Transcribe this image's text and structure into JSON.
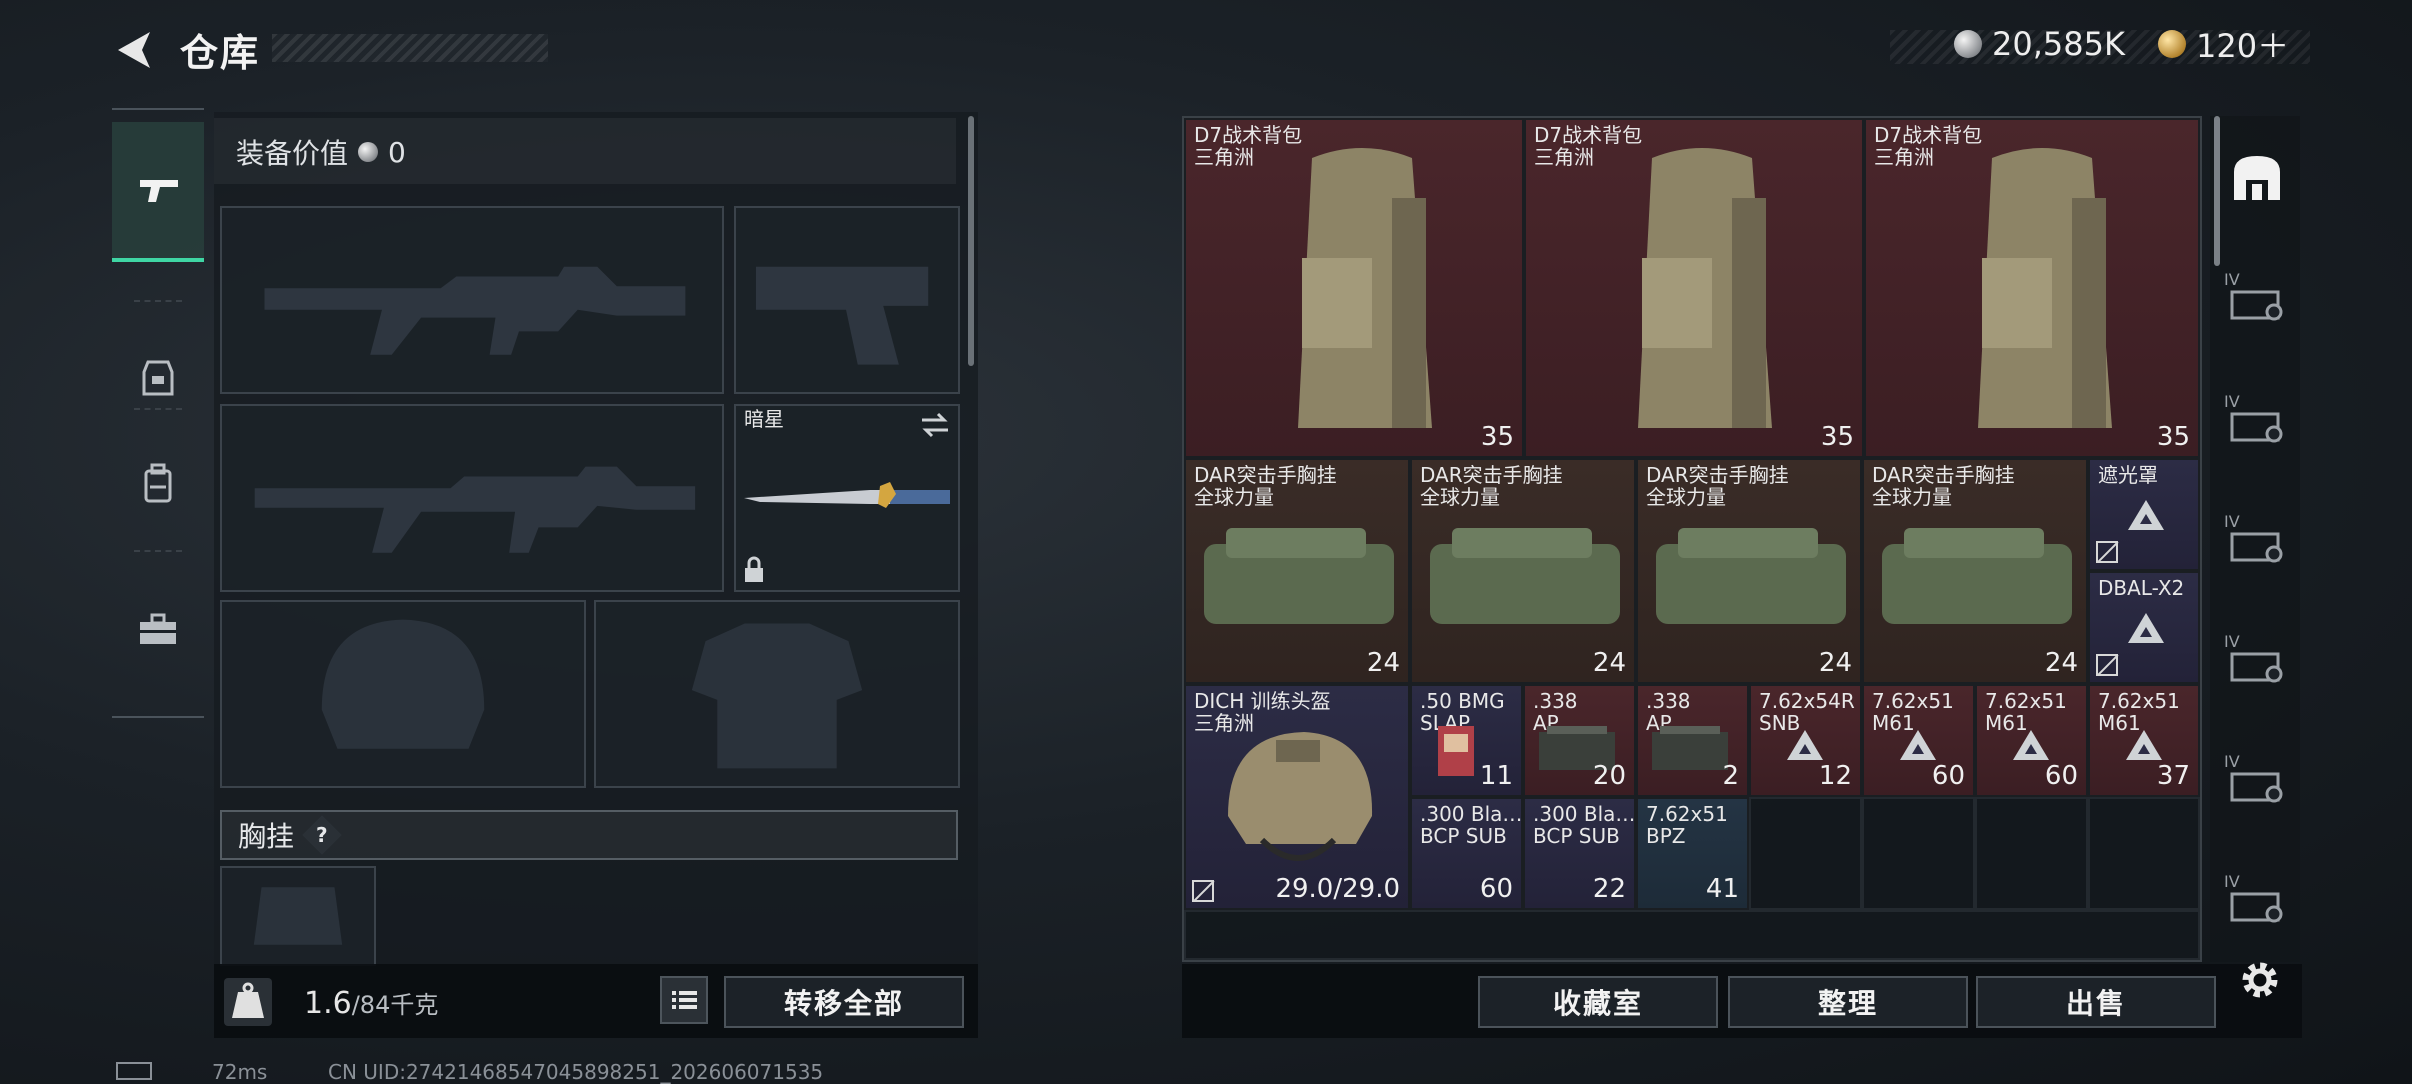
{
  "header": {
    "title": "仓库",
    "currency_silver": "20,585K",
    "currency_gold": "120＋"
  },
  "equip": {
    "value_label": "装备价值",
    "value_amount": "0",
    "knife_name": "暗星",
    "chest_label": "胸挂",
    "chest_help": "?",
    "weight_value": "1.6",
    "weight_total": "/84千克",
    "transfer_all": "转移全部"
  },
  "storage": {
    "row1": [
      {
        "name": "D7战术背包",
        "sub": "三角洲",
        "qty": "35"
      },
      {
        "name": "D7战术背包",
        "sub": "三角洲",
        "qty": "35"
      },
      {
        "name": "D7战术背包",
        "sub": "三角洲",
        "qty": "35"
      }
    ],
    "row2": [
      {
        "name": "DAR突击手胸挂",
        "sub": "全球力量",
        "qty": "24"
      },
      {
        "name": "DAR突击手胸挂",
        "sub": "全球力量",
        "qty": "24"
      },
      {
        "name": "DAR突击手胸挂",
        "sub": "全球力量",
        "qty": "24"
      },
      {
        "name": "DAR突击手胸挂",
        "sub": "全球力量",
        "qty": "24"
      }
    ],
    "small_mods": [
      {
        "name": "遮光罩"
      },
      {
        "name": "DBAL-X2"
      }
    ],
    "helmet": {
      "name": "DICH 训练头盔",
      "sub": "三角洲",
      "qty": "29.0/29.0"
    },
    "ammo_row1": [
      {
        "name": ".50 BMG",
        "sub": "SLAP",
        "qty": "11"
      },
      {
        "name": ".338",
        "sub": "AP",
        "qty": "20"
      },
      {
        "name": ".338",
        "sub": "AP",
        "qty": "2"
      },
      {
        "name": "7.62x54R",
        "sub": "SNB",
        "qty": "12"
      },
      {
        "name": "7.62x51",
        "sub": "M61",
        "qty": "60"
      },
      {
        "name": "7.62x51",
        "sub": "M61",
        "qty": "60"
      },
      {
        "name": "7.62x51",
        "sub": "M61",
        "qty": "37"
      }
    ],
    "ammo_row2": [
      {
        "name": ".300 Bla…",
        "sub": "BCP SUB",
        "qty": "60"
      },
      {
        "name": ".300 Bla…",
        "sub": "BCP SUB",
        "qty": "22"
      },
      {
        "name": "7.62x51",
        "sub": "BPZ",
        "qty": "41"
      }
    ]
  },
  "actions": {
    "collection": "收藏室",
    "organize": "整理",
    "sell": "出售"
  },
  "status": {
    "ping": "72ms",
    "uid": "CN UID:27421468547045898251_202606071535"
  },
  "right_tabs": [
    "IV",
    "IV",
    "IV",
    "IV",
    "IV",
    "IV"
  ],
  "colors": {
    "accent": "#3fd6a4",
    "cell_red": "#4a262b",
    "cell_brown": "#3a2c27",
    "cell_purple": "#2c2c45",
    "cell_blue": "#243444"
  }
}
